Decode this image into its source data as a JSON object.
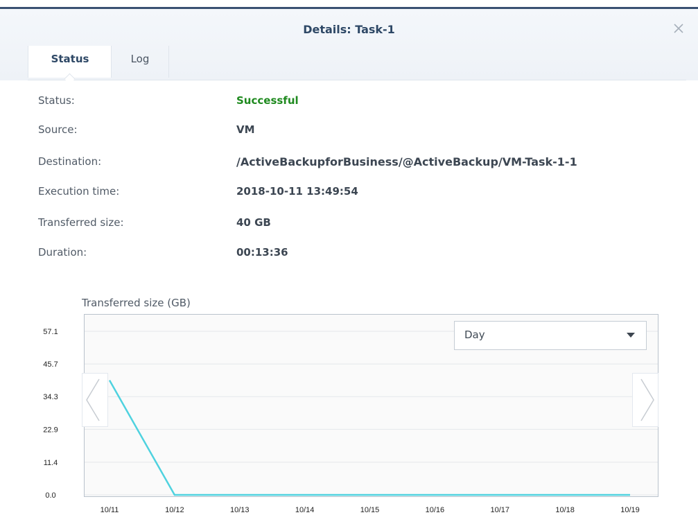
{
  "window": {
    "title": "Details: Task-1",
    "close_icon": "close-icon"
  },
  "tabs": [
    {
      "label": "Status",
      "active": true
    },
    {
      "label": "Log",
      "active": false
    }
  ],
  "details": [
    {
      "label": "Status:",
      "value": "Successful",
      "status_color": "#1f8a1f"
    },
    {
      "label": "Source:",
      "value": "VM"
    },
    {
      "label": "Destination:",
      "value": "/ActiveBackupforBusiness/@ActiveBackup/VM-Task-1-1"
    },
    {
      "label": "Execution time:",
      "value": "2018-10-11 13:49:54"
    },
    {
      "label": "Transferred size:",
      "value": "40 GB"
    },
    {
      "label": "Duration:",
      "value": "00:13:36"
    }
  ],
  "chart_controls": {
    "period_select": {
      "selected": "Day"
    },
    "prev_icon": "chevron-left-icon",
    "next_icon": "chevron-right-icon"
  },
  "chart_data": {
    "type": "line",
    "title": "Transferred size (GB)",
    "xlabel": "",
    "ylabel": "",
    "categories": [
      "10/11",
      "10/12",
      "10/13",
      "10/14",
      "10/15",
      "10/16",
      "10/17",
      "10/18",
      "10/19"
    ],
    "series": [
      {
        "values": [
          40,
          0,
          0,
          0,
          0,
          0,
          0,
          0,
          0
        ],
        "color": "#4fd2df"
      }
    ],
    "y_ticks": [
      "57.1",
      "45.7",
      "34.3",
      "22.9",
      "11.4",
      "0.0"
    ],
    "ylim": [
      0,
      57.1
    ],
    "grid": true
  }
}
